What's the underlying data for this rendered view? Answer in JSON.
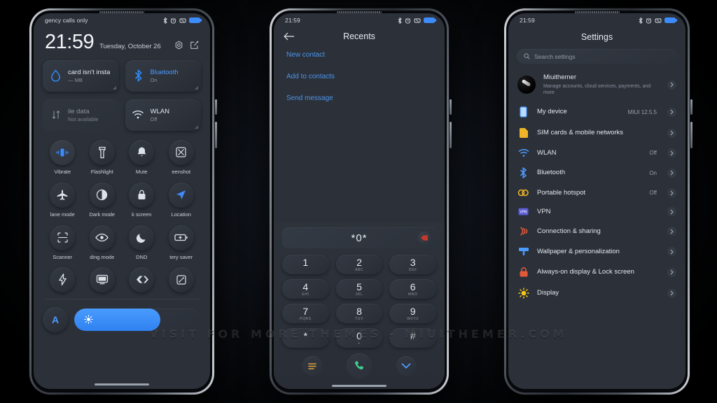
{
  "watermark": "VISIT  FOR  MORE  THEMES  -  MIUITHEMER.COM",
  "control_center": {
    "status": {
      "carrier": "gency calls only",
      "icons": [
        "bluetooth-icon",
        "alarm-icon",
        "vibrate-icon",
        "battery-icon"
      ]
    },
    "clock": "21:59",
    "date": "Tuesday, October 26",
    "actions": [
      "settings-gear-icon",
      "edit-icon"
    ],
    "big_tiles": [
      {
        "title": "card isn't insta",
        "sub": "— MB",
        "icon": "data-drop-icon",
        "state": "off"
      },
      {
        "title": "Bluetooth",
        "sub": "On",
        "icon": "bluetooth-icon",
        "state": "on"
      },
      {
        "title": "ile data",
        "sub": "Not available",
        "icon": "mobile-data-icon",
        "state": "disabled"
      },
      {
        "title": "WLAN",
        "sub": "Off",
        "icon": "wifi-icon",
        "state": "off"
      }
    ],
    "quick_tiles": [
      {
        "label": "Vibrate",
        "icon": "vibrate-icon",
        "active": true
      },
      {
        "label": "Flashlight",
        "icon": "flashlight-icon",
        "active": false
      },
      {
        "label": "Mute",
        "icon": "bell-icon",
        "active": false
      },
      {
        "label": "eenshot",
        "icon": "screenshot-icon",
        "active": false
      },
      {
        "label": "lane mode",
        "icon": "airplane-icon",
        "active": false
      },
      {
        "label": "Dark mode",
        "icon": "contrast-icon",
        "active": false
      },
      {
        "label": "k screen",
        "icon": "lock-icon",
        "active": false
      },
      {
        "label": "Location",
        "icon": "location-icon",
        "active": true
      },
      {
        "label": "Scanner",
        "icon": "scanner-icon",
        "active": false
      },
      {
        "label": "ding mode",
        "icon": "eye-icon",
        "active": false
      },
      {
        "label": "DND",
        "icon": "moon-icon",
        "active": false
      },
      {
        "label": "tery saver",
        "icon": "battery-saver-icon",
        "active": false
      }
    ],
    "bottom_tiles": [
      {
        "icon": "lightning-icon"
      },
      {
        "icon": "cast-icon"
      },
      {
        "icon": "nfc-icon"
      },
      {
        "icon": "rotate-icon"
      }
    ],
    "brightness": {
      "auto_label": "A",
      "level_percent": 68,
      "icon": "sun-icon"
    }
  },
  "dialer": {
    "status": {
      "time": "21:59",
      "icons": [
        "bluetooth-icon",
        "alarm-icon",
        "vibrate-icon",
        "battery-icon"
      ]
    },
    "title": "Recents",
    "back_icon": "back-arrow-icon",
    "actions": [
      "New contact",
      "Add to contacts",
      "Send message"
    ],
    "number": "*0*",
    "delete_icon": "backspace-icon",
    "keys": [
      {
        "digit": "1",
        "letters": ""
      },
      {
        "digit": "2",
        "letters": "ABC"
      },
      {
        "digit": "3",
        "letters": "DEF"
      },
      {
        "digit": "4",
        "letters": "GHI"
      },
      {
        "digit": "5",
        "letters": "JKL"
      },
      {
        "digit": "6",
        "letters": "MNO"
      },
      {
        "digit": "7",
        "letters": "PQRS"
      },
      {
        "digit": "8",
        "letters": "TUV"
      },
      {
        "digit": "9",
        "letters": "WXYZ"
      },
      {
        "digit": "*",
        "letters": ""
      },
      {
        "digit": "0",
        "letters": "+"
      },
      {
        "digit": "#",
        "letters": ""
      }
    ],
    "bottom": [
      {
        "icon": "menu-icon",
        "color": "#e0a33a"
      },
      {
        "icon": "call-icon",
        "color": "#3ecf8e"
      },
      {
        "icon": "chevron-down-icon",
        "color": "#4c9bff"
      }
    ]
  },
  "settings": {
    "status": {
      "time": "21:59",
      "icons": [
        "bluetooth-icon",
        "alarm-icon",
        "vibrate-icon",
        "battery-icon"
      ]
    },
    "title": "Settings",
    "search": {
      "placeholder": "Search settings",
      "icon": "search-icon"
    },
    "account": {
      "name": "Miuithemer",
      "sub": "Manage accounts, cloud services, payments, and more",
      "icon": "avatar"
    },
    "items": [
      {
        "label": "My device",
        "value": "MIUI 12.5.5",
        "icon": "phone-icon",
        "color": "#4c9bff"
      },
      {
        "label": "SIM cards & mobile networks",
        "value": "",
        "icon": "sim-icon",
        "color": "#f0b429"
      },
      {
        "label": "WLAN",
        "value": "Off",
        "icon": "wifi-icon",
        "color": "#4c9bff"
      },
      {
        "label": "Bluetooth",
        "value": "On",
        "icon": "bluetooth-icon",
        "color": "#4c9bff"
      },
      {
        "label": "Portable hotspot",
        "value": "Off",
        "icon": "hotspot-icon",
        "color": "#f0b429"
      },
      {
        "label": "VPN",
        "value": "",
        "icon": "vpn-icon",
        "color": "#5b5bd6"
      },
      {
        "label": "Connection & sharing",
        "value": "",
        "icon": "connection-icon",
        "color": "#e05a3a"
      },
      {
        "label": "Wallpaper & personalization",
        "value": "",
        "icon": "wallpaper-icon",
        "color": "#4c9bff"
      },
      {
        "label": "Always-on display & Lock screen",
        "value": "",
        "icon": "lock-screen-icon",
        "color": "#e05a3a"
      },
      {
        "label": "Display",
        "value": "",
        "icon": "display-sun-icon",
        "color": "#f5c518"
      }
    ]
  }
}
